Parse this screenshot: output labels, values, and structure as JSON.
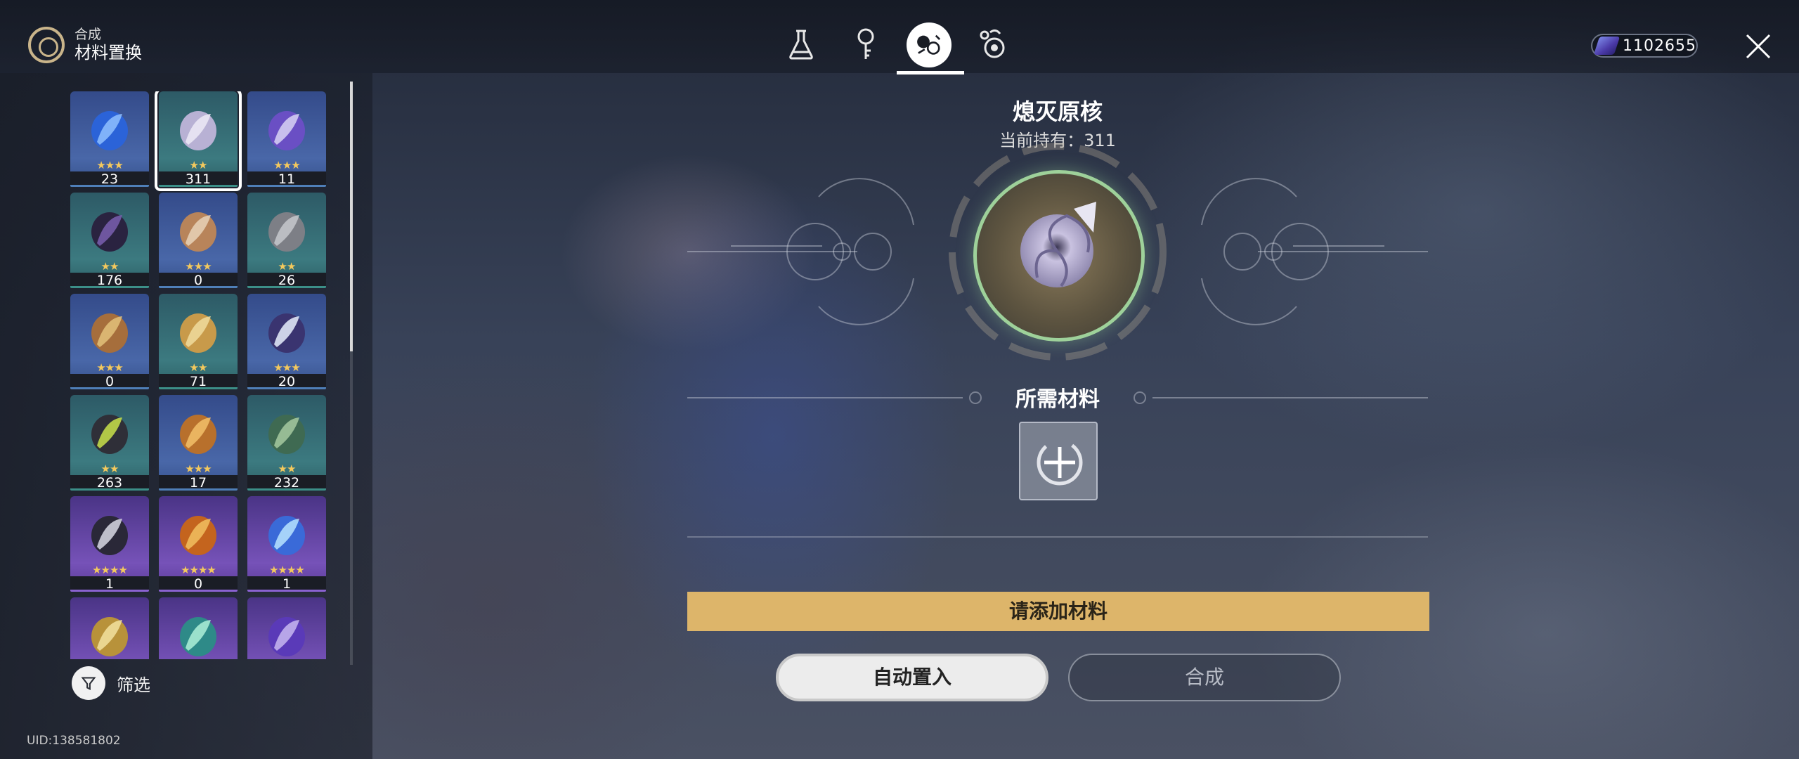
{
  "header": {
    "category": "合成",
    "title": "材料置换",
    "tabs": [
      {
        "name": "flask-icon",
        "active": false
      },
      {
        "name": "key-icon",
        "active": false
      },
      {
        "name": "exchange-icon",
        "active": true
      },
      {
        "name": "bubbles-icon",
        "active": false
      }
    ],
    "currency_value": "1102655"
  },
  "inventory": {
    "items": [
      {
        "count": "23",
        "stars": "★★★",
        "rarity": 3,
        "icon": "blue-core-icon"
      },
      {
        "count": "311",
        "stars": "★★",
        "rarity": 2,
        "icon": "silver-shell-icon",
        "selected": true
      },
      {
        "count": "11",
        "stars": "★★★",
        "rarity": 3,
        "icon": "crystal-ribbon-icon"
      },
      {
        "count": "176",
        "stars": "★★",
        "rarity": 2,
        "icon": "dark-ribbon-icon"
      },
      {
        "count": "0",
        "stars": "★★★",
        "rarity": 3,
        "icon": "bone-key-icon"
      },
      {
        "count": "26",
        "stars": "★★",
        "rarity": 2,
        "icon": "gear-pair-icon"
      },
      {
        "count": "0",
        "stars": "★★★",
        "rarity": 3,
        "icon": "mech-arm-icon"
      },
      {
        "count": "71",
        "stars": "★★",
        "rarity": 2,
        "icon": "gold-gear-icon"
      },
      {
        "count": "20",
        "stars": "★★★",
        "rarity": 3,
        "icon": "flower-branch-icon"
      },
      {
        "count": "263",
        "stars": "★★",
        "rarity": 2,
        "icon": "twig-icon"
      },
      {
        "count": "17",
        "stars": "★★★",
        "rarity": 3,
        "icon": "gear-ring-icon"
      },
      {
        "count": "232",
        "stars": "★★",
        "rarity": 2,
        "icon": "green-box-icon"
      },
      {
        "count": "1",
        "stars": "★★★★",
        "rarity": 4,
        "icon": "dark-blade-icon"
      },
      {
        "count": "0",
        "stars": "★★★★",
        "rarity": 4,
        "icon": "amber-shard-icon"
      },
      {
        "count": "1",
        "stars": "★★★★",
        "rarity": 4,
        "icon": "blue-crystal-icon"
      },
      {
        "count": "",
        "stars": "",
        "rarity": 4,
        "icon": "gold-spike-icon"
      },
      {
        "count": "",
        "stars": "",
        "rarity": 4,
        "icon": "teal-leaf-icon"
      },
      {
        "count": "",
        "stars": "",
        "rarity": 4,
        "icon": "purple-pixel-icon"
      }
    ],
    "filter_label": "筛选",
    "uid": "UID:138581802"
  },
  "detail": {
    "item_name": "熄灭原核",
    "held_text": "当前持有：311",
    "required_label": "所需材料",
    "hint": "请添加材料",
    "auto_button": "自动置入",
    "craft_button": "合成"
  },
  "colors": {
    "accent_gold": "#ddb56a",
    "orb_ring": "#9ed19a",
    "star": "#f4c95d"
  }
}
